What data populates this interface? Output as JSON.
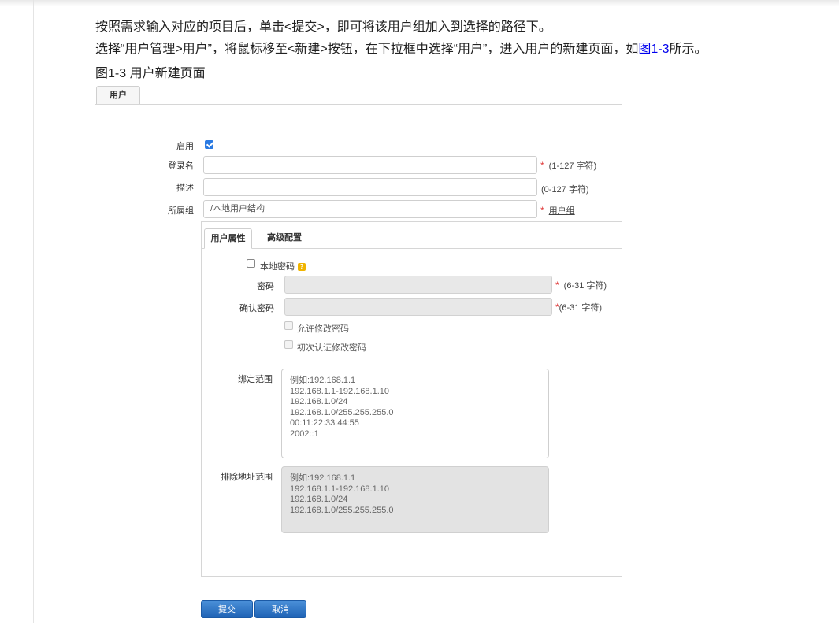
{
  "doc": {
    "line1": "按照需求输入对应的项目后，单击<提交>，即可将该用户组加入到选择的路径下。",
    "line2_pre": "选择“用户管理>用户”，将鼠标移至<新建>按钮，在下拉框中选择“用户”，进入用户的新建页面，如",
    "line2_link": "图1-3",
    "line2_post": "所示。",
    "figure_caption": "图1-3 用户新建页面"
  },
  "form": {
    "tab": "用户",
    "enable_label": "启用",
    "enable_checked": true,
    "login_label": "登录名",
    "login_value": "",
    "login_hint": "(1-127 字符)",
    "desc_label": "描述",
    "desc_value": "",
    "desc_hint": "(0-127 字符)",
    "group_label": "所属组",
    "group_value": "/本地用户结构",
    "group_link": "用户组",
    "required_mark": "*"
  },
  "panel": {
    "tabs": [
      "用户属性",
      "高级配置"
    ],
    "active_tab": 0,
    "local_pwd_label": "本地密码",
    "local_pwd_checked": false,
    "help_icon": "?",
    "pwd_label": "密码",
    "pwd_hint": "(6-31 字符)",
    "confirm_label": "确认密码",
    "confirm_hint": "(6-31 字符)",
    "allow_change_label": "允许修改密码",
    "first_change_label": "初次认证修改密码",
    "bind_label": "绑定范围",
    "bind_placeholder": "例如:192.168.1.1\n192.168.1.1-192.168.1.10\n192.168.1.0/24\n192.168.1.0/255.255.255.0\n00:11:22:33:44:55\n2002::1",
    "exclude_label": "排除地址范围",
    "exclude_placeholder": "例如:192.168.1.1\n192.168.1.1-192.168.1.10\n192.168.1.0/24\n192.168.1.0/255.255.255.0"
  },
  "buttons": {
    "submit": "提交",
    "cancel": "取消"
  }
}
